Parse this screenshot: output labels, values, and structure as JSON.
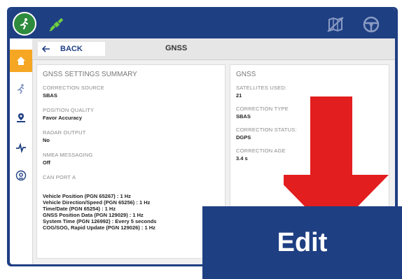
{
  "topbar": {
    "logo_icon": "running-person-icon",
    "satellite_icon": "satellite-icon",
    "map_off_icon": "map-off-icon",
    "steering_icon": "steering-wheel-icon",
    "color": "#1f3f83"
  },
  "sidebar": {
    "items": [
      {
        "icon": "home-icon",
        "active": true
      },
      {
        "icon": "running-person-icon",
        "active": false
      },
      {
        "icon": "location-icon",
        "active": false
      },
      {
        "icon": "pulse-icon",
        "active": false
      },
      {
        "icon": "gear-badge-icon",
        "active": false
      }
    ],
    "active_color": "#f5a623"
  },
  "nav": {
    "back_label": "BACK",
    "title": "GNSS"
  },
  "summary": {
    "heading": "GNSS SETTINGS SUMMARY",
    "fields": [
      {
        "label": "CORRECTION SOURCE",
        "value": "SBAS"
      },
      {
        "label": "POSITION QUALITY",
        "value": "Favor Accuracy"
      },
      {
        "label": "RADAR OUTPUT",
        "value": "No"
      },
      {
        "label": "NMEA MESSAGING",
        "value": "Off"
      }
    ],
    "can_label": "CAN PORT A",
    "can_lines": [
      "Vehicle Position (PGN 65267) : 1 Hz",
      "Vehicle Direction/Speed (PGN 65256) : 1 Hz",
      "Time/Date (PGN 65254) : 1 Hz",
      "GNSS Position Data (PGN 129029) : 1 Hz",
      "System Time (PGN 126992) : Every 5 seconds",
      "COG/SOG, Rapid Update (PGN 129026) : 1 Hz"
    ]
  },
  "gnss": {
    "heading": "GNSS",
    "fields": [
      {
        "label": "SATELLITES USED:",
        "value": "21"
      },
      {
        "label": "CORRECTION TYPE",
        "value": "SBAS"
      },
      {
        "label": "CORRECTION STATUS:",
        "value": "DGPS"
      },
      {
        "label": "CORRECTION AGE",
        "value": "3.4 s"
      }
    ]
  },
  "overlay": {
    "edit_label": "Edit",
    "arrow_color": "#e31e1e",
    "box_color": "#1f3f83"
  }
}
